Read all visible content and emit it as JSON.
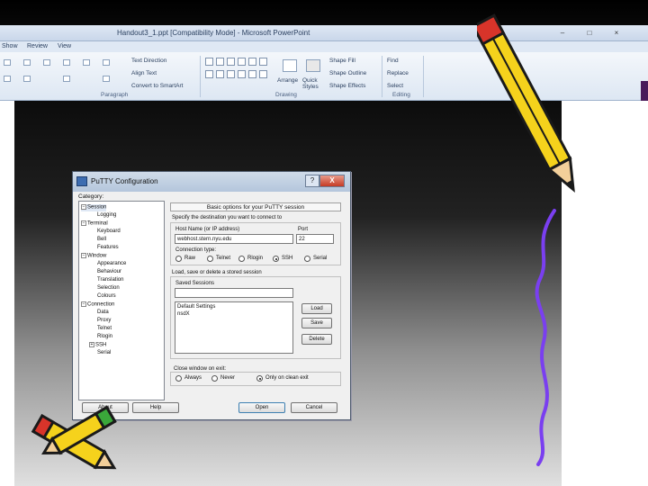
{
  "ppt": {
    "title": "Handout3_1.ppt [Compatibility Mode] - Microsoft PowerPoint",
    "tabs": [
      "Show",
      "Review",
      "View"
    ],
    "ribbon": {
      "text_direction": "Text Direction",
      "align_text": "Align Text",
      "convert_smartart": "Convert to SmartArt",
      "paragraph_label": "Paragraph",
      "arrange": "Arrange",
      "quick_styles": "Quick Styles",
      "shape_fill": "Shape Fill",
      "shape_outline": "Shape Outline",
      "shape_effects": "Shape Effects",
      "drawing_label": "Drawing",
      "find": "Find",
      "replace": "Replace",
      "select": "Select",
      "editing_label": "Editing"
    }
  },
  "putty": {
    "title": "PuTTY Configuration",
    "category_label": "Category:",
    "tree": [
      {
        "label": "Session",
        "box": "−"
      },
      {
        "label": "Logging"
      },
      {
        "label": "Terminal",
        "box": "−"
      },
      {
        "label": "Keyboard"
      },
      {
        "label": "Bell"
      },
      {
        "label": "Features"
      },
      {
        "label": "Window",
        "box": "−"
      },
      {
        "label": "Appearance"
      },
      {
        "label": "Behaviour"
      },
      {
        "label": "Translation"
      },
      {
        "label": "Selection"
      },
      {
        "label": "Colours"
      },
      {
        "label": "Connection",
        "box": "−"
      },
      {
        "label": "Data"
      },
      {
        "label": "Proxy"
      },
      {
        "label": "Telnet"
      },
      {
        "label": "Rlogin"
      },
      {
        "label": "SSH",
        "box": "+"
      },
      {
        "label": "Serial"
      }
    ],
    "panel_header": "Basic options for your PuTTY session",
    "destination_label": "Specify the destination you want to connect to",
    "hostname_label": "Host Name (or IP address)",
    "hostname_value": "webhost.stern.nyu.edu",
    "port_label": "Port",
    "port_value": "22",
    "connection_type_label": "Connection type:",
    "connection_types": [
      "Raw",
      "Telnet",
      "Rlogin",
      "SSH",
      "Serial"
    ],
    "connection_selected": "SSH",
    "load_save_label": "Load, save or delete a stored session",
    "saved_sessions_label": "Saved Sessions",
    "saved_sessions_value": "",
    "sessions": [
      "Default Settings",
      "nsdX"
    ],
    "load_button": "Load",
    "save_button": "Save",
    "delete_button": "Delete",
    "close_window_label": "Close window on exit:",
    "close_options": [
      "Always",
      "Never",
      "Only on clean exit"
    ],
    "close_selected": "Only on clean exit",
    "about_button": "About",
    "help_button": "Help",
    "open_button": "Open",
    "cancel_button": "Cancel",
    "help_glyph": "?",
    "close_glyph": "X"
  },
  "colors": {
    "pencil_yellow": "#f5d21c",
    "pencil_outline": "#1a1a1a",
    "squiggle": "#7a3ff0",
    "eraser_red": "#d8342a"
  }
}
